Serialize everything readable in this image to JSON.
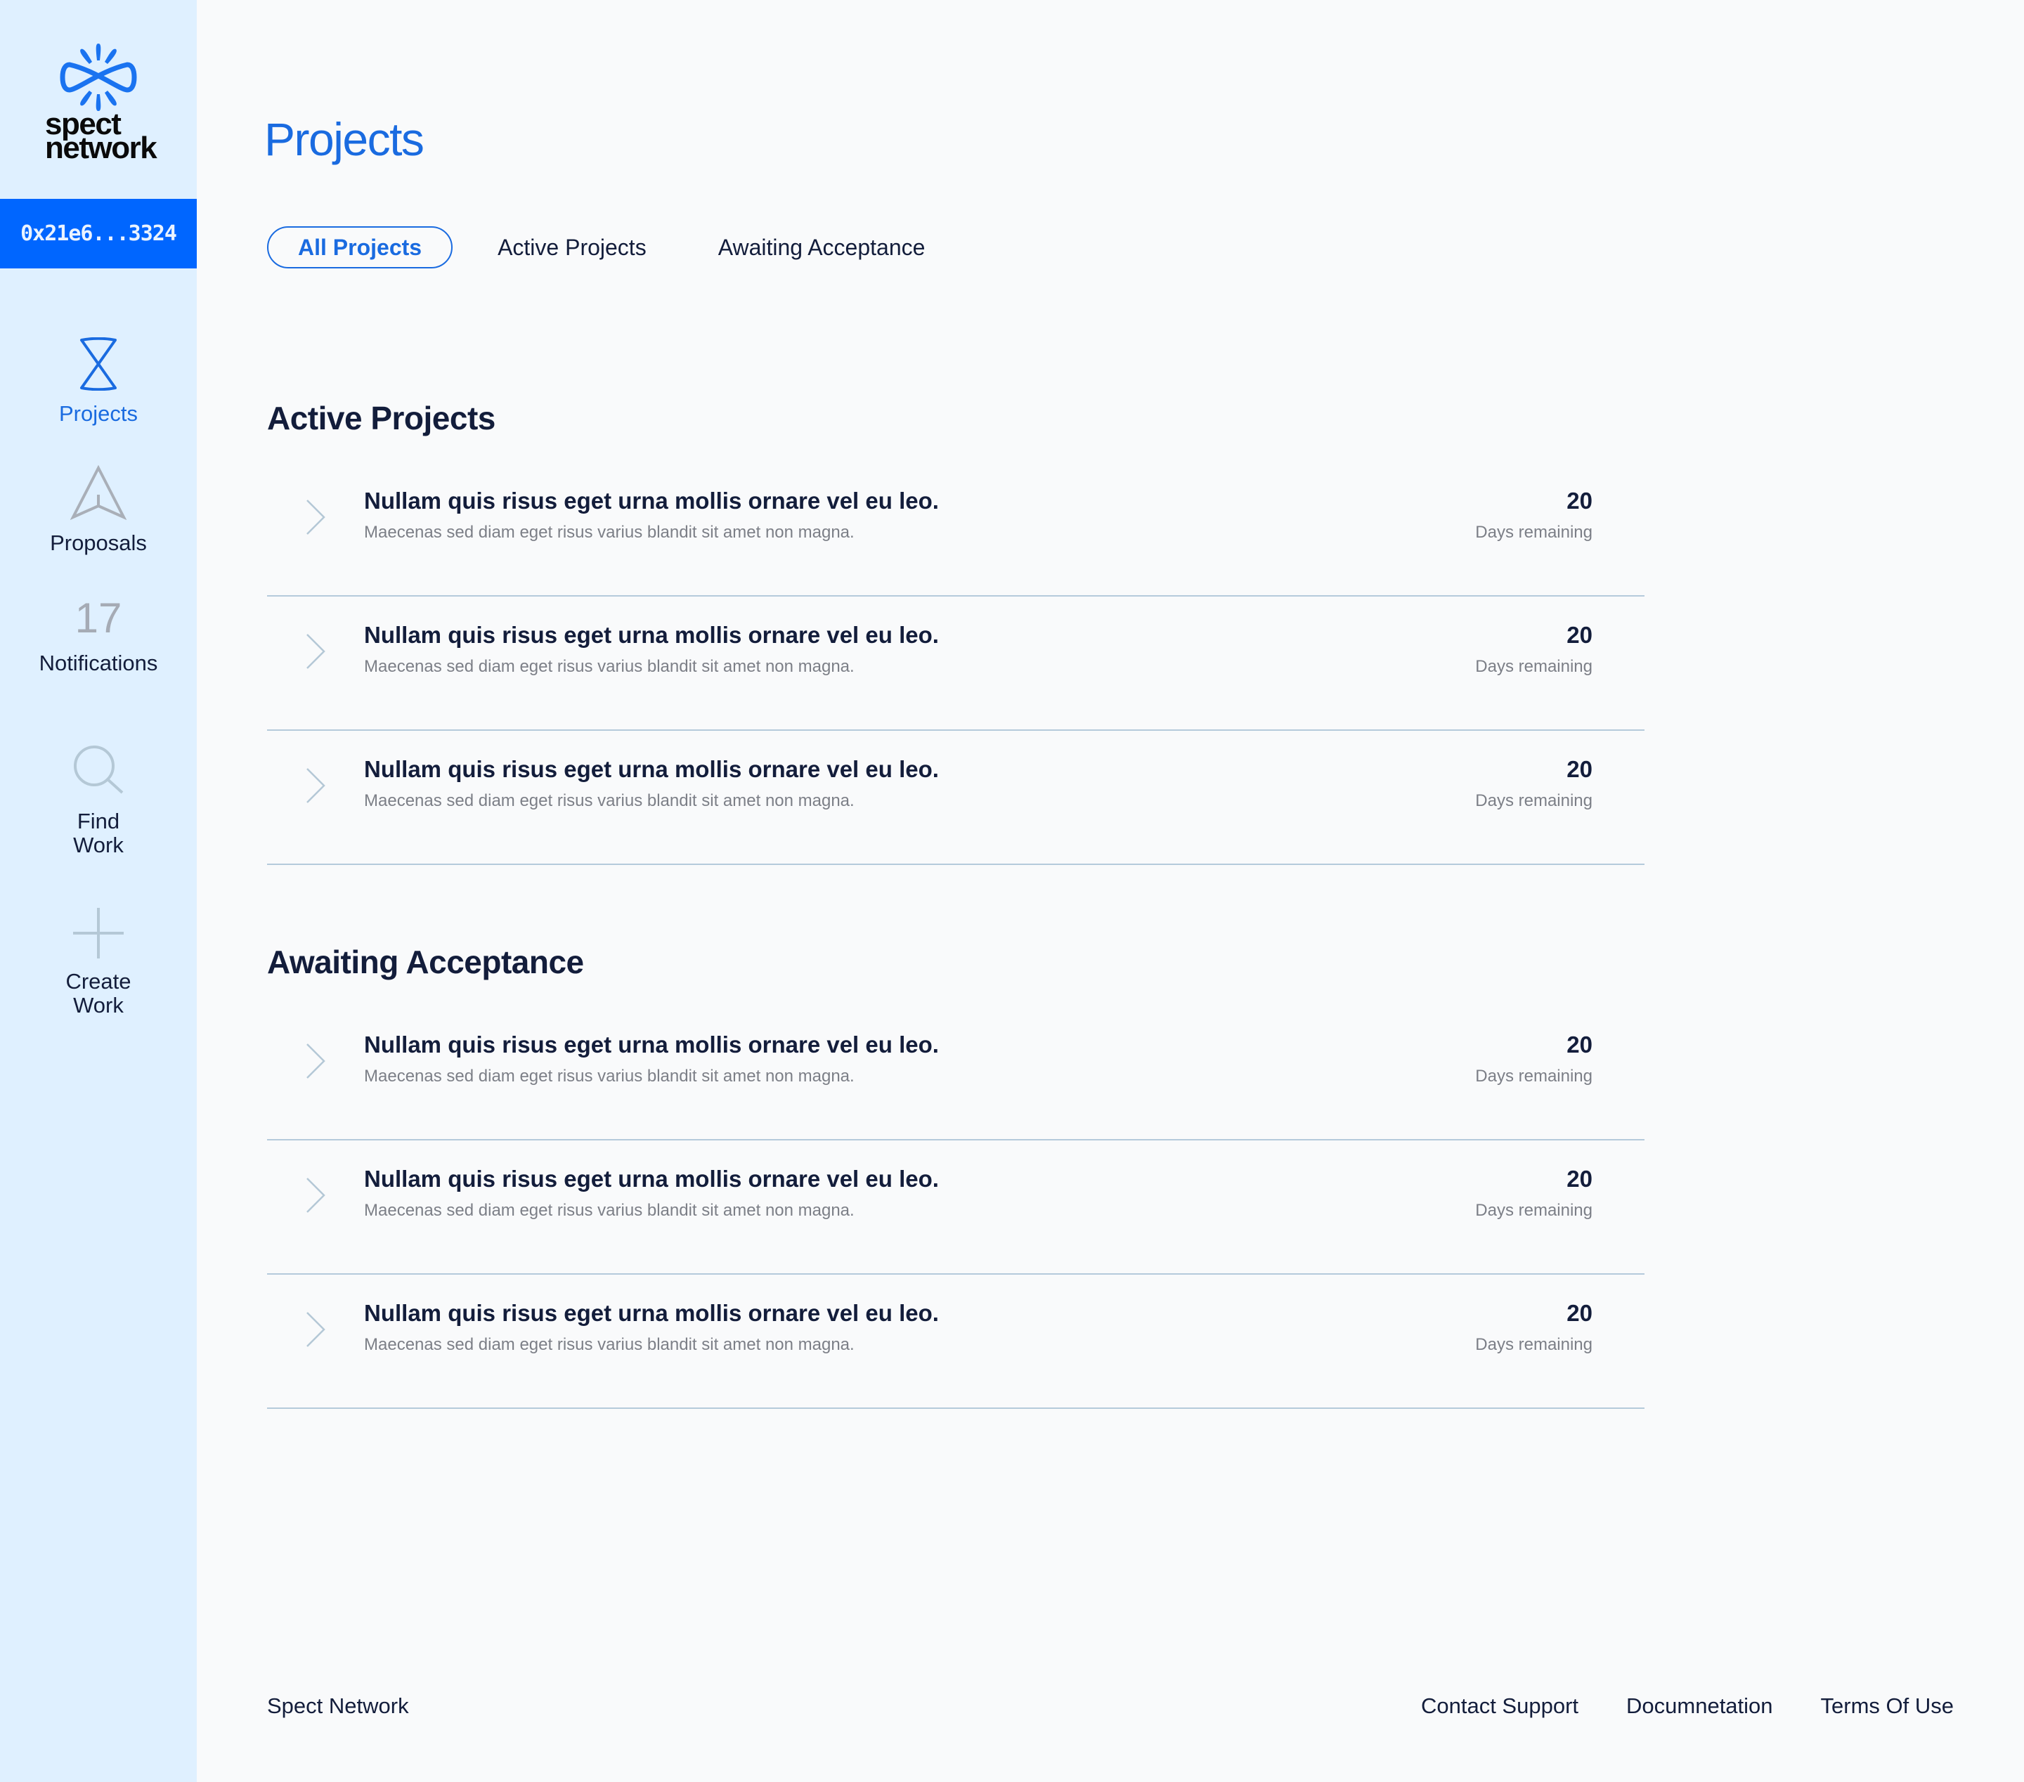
{
  "brand": {
    "logo_line1": "spect",
    "logo_line2": "network",
    "accent_color": "#0066FF"
  },
  "wallet": {
    "address": "0x21e6...3324"
  },
  "sidebar": {
    "items": [
      {
        "label": "Projects",
        "icon": "hourglass-icon",
        "active": true
      },
      {
        "label": "Proposals",
        "icon": "paper-plane-icon",
        "active": false
      },
      {
        "label": "Notifications",
        "count": "17",
        "active": false
      },
      {
        "label_line1": "Find",
        "label_line2": "Work",
        "icon": "search-icon",
        "active": false
      },
      {
        "label_line1": "Create",
        "label_line2": "Work",
        "icon": "plus-icon",
        "active": false
      }
    ]
  },
  "page": {
    "title": "Projects"
  },
  "tabs": [
    {
      "label": "All Projects",
      "active": true
    },
    {
      "label": "Active Projects",
      "active": false
    },
    {
      "label": "Awaiting Acceptance",
      "active": false
    }
  ],
  "sections": [
    {
      "heading": "Active Projects",
      "rows": [
        {
          "title": "Nullam quis risus eget urna mollis ornare vel eu leo.",
          "subtitle": "Maecenas sed diam eget risus varius blandit sit amet non magna.",
          "days": "20",
          "days_label": "Days remaining"
        },
        {
          "title": "Nullam quis risus eget urna mollis ornare vel eu leo.",
          "subtitle": "Maecenas sed diam eget risus varius blandit sit amet non magna.",
          "days": "20",
          "days_label": "Days remaining"
        },
        {
          "title": "Nullam quis risus eget urna mollis ornare vel eu leo.",
          "subtitle": "Maecenas sed diam eget risus varius blandit sit amet non magna.",
          "days": "20",
          "days_label": "Days remaining"
        }
      ]
    },
    {
      "heading": "Awaiting Acceptance",
      "rows": [
        {
          "title": "Nullam quis risus eget urna mollis ornare vel eu leo.",
          "subtitle": "Maecenas sed diam eget risus varius blandit sit amet non magna.",
          "days": "20",
          "days_label": "Days remaining"
        },
        {
          "title": "Nullam quis risus eget urna mollis ornare vel eu leo.",
          "subtitle": "Maecenas sed diam eget risus varius blandit sit amet non magna.",
          "days": "20",
          "days_label": "Days remaining"
        },
        {
          "title": "Nullam quis risus eget urna mollis ornare vel eu leo.",
          "subtitle": "Maecenas sed diam eget risus varius blandit sit amet non magna.",
          "days": "20",
          "days_label": "Days remaining"
        }
      ]
    }
  ],
  "footer": {
    "brand": "Spect Network",
    "links": [
      "Contact Support",
      "Documnetation",
      "Terms Of Use"
    ]
  }
}
